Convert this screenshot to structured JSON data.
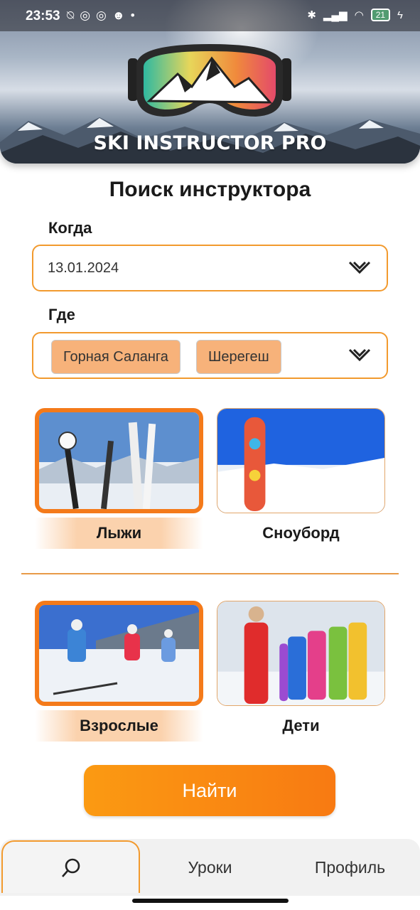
{
  "status_bar": {
    "time": "23:53",
    "left_icons": [
      "alarm-off-icon",
      "vpn-icon",
      "vpn-icon",
      "discord-icon",
      "dot-icon"
    ],
    "battery": "21"
  },
  "header": {
    "brand": "SKI INSTRUCTOR PRO"
  },
  "page": {
    "title": "Поиск инструктора"
  },
  "when": {
    "label": "Когда",
    "value": "13.01.2024"
  },
  "where": {
    "label": "Где",
    "chips": [
      "Горная Саланга",
      "Шерегеш"
    ]
  },
  "sport": {
    "options": [
      {
        "label": "Лыжи",
        "selected": true
      },
      {
        "label": "Сноуборд",
        "selected": false
      }
    ]
  },
  "age": {
    "options": [
      {
        "label": "Взрослые",
        "selected": true
      },
      {
        "label": "Дети",
        "selected": false
      }
    ]
  },
  "search_button": {
    "label": "Найти"
  },
  "bottom_nav": {
    "items": [
      {
        "label": "",
        "icon": "search-icon",
        "active": true
      },
      {
        "label": "Уроки",
        "active": false
      },
      {
        "label": "Профиль",
        "active": false
      }
    ]
  },
  "colors": {
    "accent": "#f47a1a",
    "chip": "#f7b27a",
    "border": "#f29a2e"
  }
}
